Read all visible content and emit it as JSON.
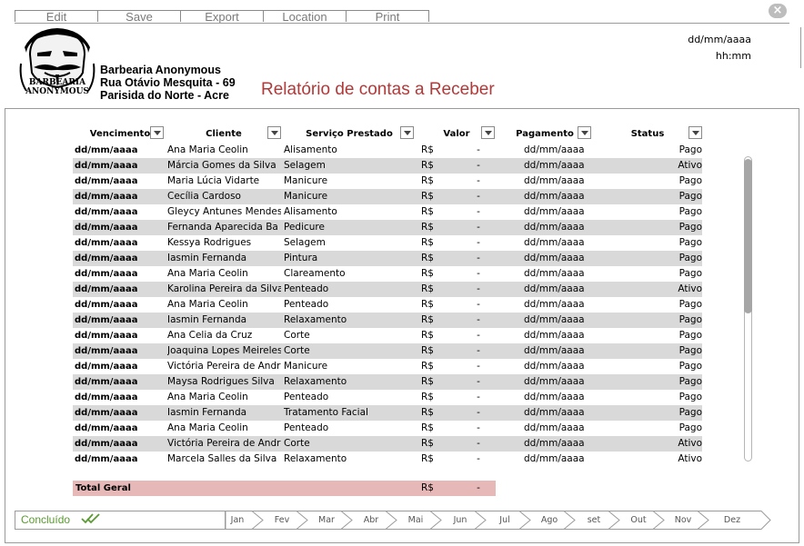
{
  "toolbar": {
    "buttons": [
      "Edit",
      "Save",
      "Export",
      "Location",
      "Print"
    ],
    "close": "×"
  },
  "header": {
    "logo_text": [
      "BARBEARIA",
      "ANONYMOUS"
    ],
    "company_name": "Barbearia Anonymous",
    "address": "Rua Otávio Mesquita - 69",
    "city": "Parisida do Norte - Acre",
    "report_title": "Relatório de contas a Receber",
    "date": "dd/mm/aaaa",
    "time": "hh:mm"
  },
  "table": {
    "columns": [
      "Vencimento",
      "Cliente",
      "Serviço Prestado",
      "Valor",
      "Pagamento",
      "Status"
    ],
    "rows": [
      {
        "vencimento": "dd/mm/aaaa",
        "cliente": "Ana Maria Ceolin",
        "servico": "Alisamento",
        "rs": "R$",
        "valor": "-",
        "pagamento": "dd/mm/aaaa",
        "status": "Pago"
      },
      {
        "vencimento": "dd/mm/aaaa",
        "cliente": "Márcia Gomes da Silva",
        "servico": "Selagem",
        "rs": "R$",
        "valor": "-",
        "pagamento": "dd/mm/aaaa",
        "status": "Ativo"
      },
      {
        "vencimento": "dd/mm/aaaa",
        "cliente": "Maria Lúcia Vidarte",
        "servico": "Manicure",
        "rs": "R$",
        "valor": "-",
        "pagamento": "dd/mm/aaaa",
        "status": "Pago"
      },
      {
        "vencimento": "dd/mm/aaaa",
        "cliente": "Cecília Cardoso",
        "servico": "Manicure",
        "rs": "R$",
        "valor": "-",
        "pagamento": "dd/mm/aaaa",
        "status": "Pago"
      },
      {
        "vencimento": "dd/mm/aaaa",
        "cliente": "Gleycy Antunes Mendes",
        "servico": "Alisamento",
        "rs": "R$",
        "valor": "-",
        "pagamento": "dd/mm/aaaa",
        "status": "Pago"
      },
      {
        "vencimento": "dd/mm/aaaa",
        "cliente": "Fernanda Aparecida Ba",
        "servico": "Pedicure",
        "rs": "R$",
        "valor": "-",
        "pagamento": "dd/mm/aaaa",
        "status": "Pago"
      },
      {
        "vencimento": "dd/mm/aaaa",
        "cliente": "Kessya Rodrigues",
        "servico": "Selagem",
        "rs": "R$",
        "valor": "-",
        "pagamento": "dd/mm/aaaa",
        "status": "Pago"
      },
      {
        "vencimento": "dd/mm/aaaa",
        "cliente": "Iasmin Fernanda",
        "servico": "Pintura",
        "rs": "R$",
        "valor": "-",
        "pagamento": "dd/mm/aaaa",
        "status": "Pago"
      },
      {
        "vencimento": "dd/mm/aaaa",
        "cliente": "Ana Maria Ceolin",
        "servico": "Clareamento",
        "rs": "R$",
        "valor": "-",
        "pagamento": "dd/mm/aaaa",
        "status": "Pago"
      },
      {
        "vencimento": "dd/mm/aaaa",
        "cliente": "Karolina Pereira da Silva",
        "servico": "Penteado",
        "rs": "R$",
        "valor": "-",
        "pagamento": "dd/mm/aaaa",
        "status": "Ativo"
      },
      {
        "vencimento": "dd/mm/aaaa",
        "cliente": "Ana Maria Ceolin",
        "servico": "Penteado",
        "rs": "R$",
        "valor": "-",
        "pagamento": "dd/mm/aaaa",
        "status": "Pago"
      },
      {
        "vencimento": "dd/mm/aaaa",
        "cliente": "Iasmin Fernanda",
        "servico": "Relaxamento",
        "rs": "R$",
        "valor": "-",
        "pagamento": "dd/mm/aaaa",
        "status": "Pago"
      },
      {
        "vencimento": "dd/mm/aaaa",
        "cliente": "Ana Celia da Cruz",
        "servico": "Corte",
        "rs": "R$",
        "valor": "-",
        "pagamento": "dd/mm/aaaa",
        "status": "Pago"
      },
      {
        "vencimento": "dd/mm/aaaa",
        "cliente": "Joaquina Lopes Meireles",
        "servico": "Corte",
        "rs": "R$",
        "valor": "-",
        "pagamento": "dd/mm/aaaa",
        "status": "Pago"
      },
      {
        "vencimento": "dd/mm/aaaa",
        "cliente": "Victória Pereira de Andrade",
        "servico": "Manicure",
        "rs": "R$",
        "valor": "-",
        "pagamento": "dd/mm/aaaa",
        "status": "Pago"
      },
      {
        "vencimento": "dd/mm/aaaa",
        "cliente": "Maysa Rodrigues Silva",
        "servico": "Relaxamento",
        "rs": "R$",
        "valor": "-",
        "pagamento": "dd/mm/aaaa",
        "status": "Pago"
      },
      {
        "vencimento": "dd/mm/aaaa",
        "cliente": "Ana Maria Ceolin",
        "servico": "Penteado",
        "rs": "R$",
        "valor": "-",
        "pagamento": "dd/mm/aaaa",
        "status": "Pago"
      },
      {
        "vencimento": "dd/mm/aaaa",
        "cliente": "Iasmin Fernanda",
        "servico": "Tratamento Facial",
        "rs": "R$",
        "valor": "-",
        "pagamento": "dd/mm/aaaa",
        "status": "Pago"
      },
      {
        "vencimento": "dd/mm/aaaa",
        "cliente": "Ana Maria Ceolin",
        "servico": "Penteado",
        "rs": "R$",
        "valor": "-",
        "pagamento": "dd/mm/aaaa",
        "status": "Pago"
      },
      {
        "vencimento": "dd/mm/aaaa",
        "cliente": "Victória Pereira de Andrade",
        "servico": "Corte",
        "rs": "R$",
        "valor": "-",
        "pagamento": "dd/mm/aaaa",
        "status": "Ativo"
      },
      {
        "vencimento": "dd/mm/aaaa",
        "cliente": "Marcela Salles da Silva",
        "servico": "Relaxamento",
        "rs": "R$",
        "valor": "-",
        "pagamento": "dd/mm/aaaa",
        "status": "Ativo"
      }
    ],
    "total": {
      "label": "Total Geral",
      "rs": "R$",
      "valor": "-"
    }
  },
  "footer": {
    "status": "Concluído",
    "months": [
      "Jan",
      "Fev",
      "Mar",
      "Abr",
      "Mai",
      "Jun",
      "Jul",
      "Ago",
      "set",
      "Out",
      "Nov",
      "Dez"
    ]
  },
  "colors": {
    "title_red": "#b03a3a",
    "row_alt": "#d9d9d9",
    "total_bg": "#e6b8b7",
    "status_green": "#5a9a32"
  }
}
